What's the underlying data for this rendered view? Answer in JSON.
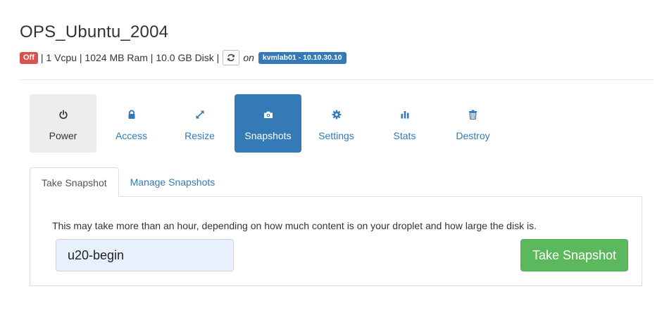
{
  "server": {
    "name": "OPS_Ubuntu_2004",
    "status": "Off",
    "specs": "| 1 Vcpu | 1024 MB Ram | 10.0 GB Disk |",
    "on_label": "on",
    "host": "kvmlab01 - 10.10.30.10"
  },
  "actions": [
    {
      "label": "Power",
      "icon": "power-icon"
    },
    {
      "label": "Access",
      "icon": "lock-icon"
    },
    {
      "label": "Resize",
      "icon": "resize-icon"
    },
    {
      "label": "Snapshots",
      "icon": "camera-icon"
    },
    {
      "label": "Settings",
      "icon": "gear-icon"
    },
    {
      "label": "Stats",
      "icon": "bar-chart-icon"
    },
    {
      "label": "Destroy",
      "icon": "trash-icon"
    }
  ],
  "tabs": [
    {
      "label": "Take Snapshot"
    },
    {
      "label": "Manage Snapshots"
    }
  ],
  "snapshot": {
    "description": "This may take more than an hour, depending on how much content is on your droplet and how large the disk is.",
    "name_value": "u20-begin",
    "button_label": "Take Snapshot"
  },
  "colors": {
    "primary": "#337ab7",
    "danger": "#d9534f",
    "success": "#5cb85c"
  }
}
